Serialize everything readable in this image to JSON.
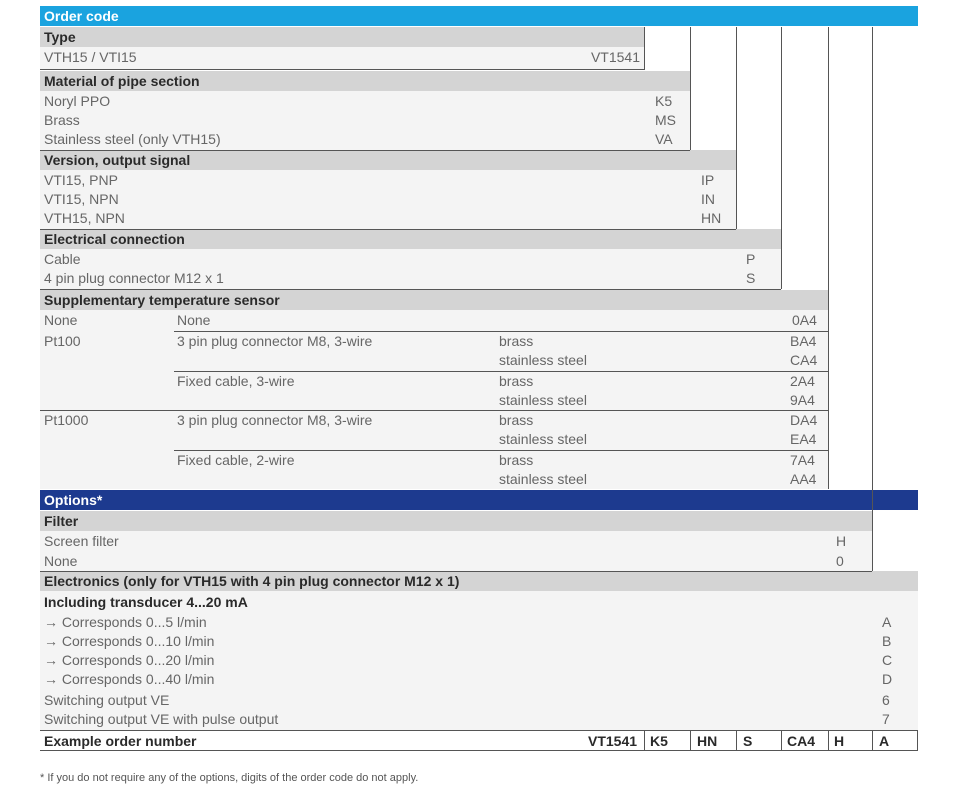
{
  "order_code_title": "Order code",
  "type": {
    "title": "Type",
    "rows": [
      {
        "label": "VTH15 / VTI15",
        "code": "VT1541"
      }
    ]
  },
  "material": {
    "title": "Material of pipe section",
    "rows": [
      {
        "label": "Noryl PPO",
        "code": "K5"
      },
      {
        "label": "Brass",
        "code": "MS"
      },
      {
        "label": "Stainless steel (only VTH15)",
        "code": "VA"
      }
    ]
  },
  "version": {
    "title": "Version, output signal",
    "rows": [
      {
        "label": "VTI15, PNP",
        "code": "IP"
      },
      {
        "label": "VTI15, NPN",
        "code": "IN"
      },
      {
        "label": "VTH15, NPN",
        "code": "HN"
      }
    ]
  },
  "electrical": {
    "title": "Electrical connection",
    "rows": [
      {
        "label": "Cable",
        "code": "P"
      },
      {
        "label": "4 pin plug connector M12 x 1",
        "code": "S"
      }
    ]
  },
  "temp_sensor": {
    "title": "Supplementary temperature sensor",
    "none": {
      "sensor": "None",
      "connection": "None",
      "code": "0A4"
    },
    "pt100": {
      "sensor": "Pt100",
      "plug": {
        "connection": "3 pin plug connector M8, 3-wire",
        "m1": "brass",
        "c1": "BA4",
        "m2": "stainless steel",
        "c2": "CA4"
      },
      "cable": {
        "connection": "Fixed cable, 3-wire",
        "m1": "brass",
        "c1": "2A4",
        "m2": "stainless steel",
        "c2": "9A4"
      }
    },
    "pt1000": {
      "sensor": "Pt1000",
      "plug": {
        "connection": "3 pin plug connector M8, 3-wire",
        "m1": "brass",
        "c1": "DA4",
        "m2": "stainless steel",
        "c2": "EA4"
      },
      "cable": {
        "connection": "Fixed cable, 2-wire",
        "m1": "brass",
        "c1": "7A4",
        "m2": "stainless steel",
        "c2": "AA4"
      }
    }
  },
  "options_title": "Options*",
  "filter": {
    "title": "Filter",
    "rows": [
      {
        "label": "Screen filter",
        "code": "H"
      },
      {
        "label": "None",
        "code": "0"
      }
    ]
  },
  "electronics": {
    "title": "Electronics (only for VTH15 with 4 pin plug connector M12 x 1)",
    "subtitle": "Including transducer 4...20 mA",
    "rows": [
      {
        "label": "→ Corresponds 0...5 l/min",
        "code": "A"
      },
      {
        "label": "→ Corresponds 0...10 l/min",
        "code": "B"
      },
      {
        "label": "→ Corresponds 0...20 l/min",
        "code": "C"
      },
      {
        "label": "→ Corresponds 0...40 l/min",
        "code": "D"
      },
      {
        "label": "Switching output VE",
        "code": "6"
      },
      {
        "label": "Switching output VE with pulse output",
        "code": "7"
      }
    ]
  },
  "example": {
    "label": "Example order number",
    "codes": [
      "VT1541",
      "K5",
      "HN",
      "S",
      "CA4",
      "H",
      "A"
    ]
  },
  "footnote": "*  If you do not require any of the options, digits of the order code do not apply."
}
